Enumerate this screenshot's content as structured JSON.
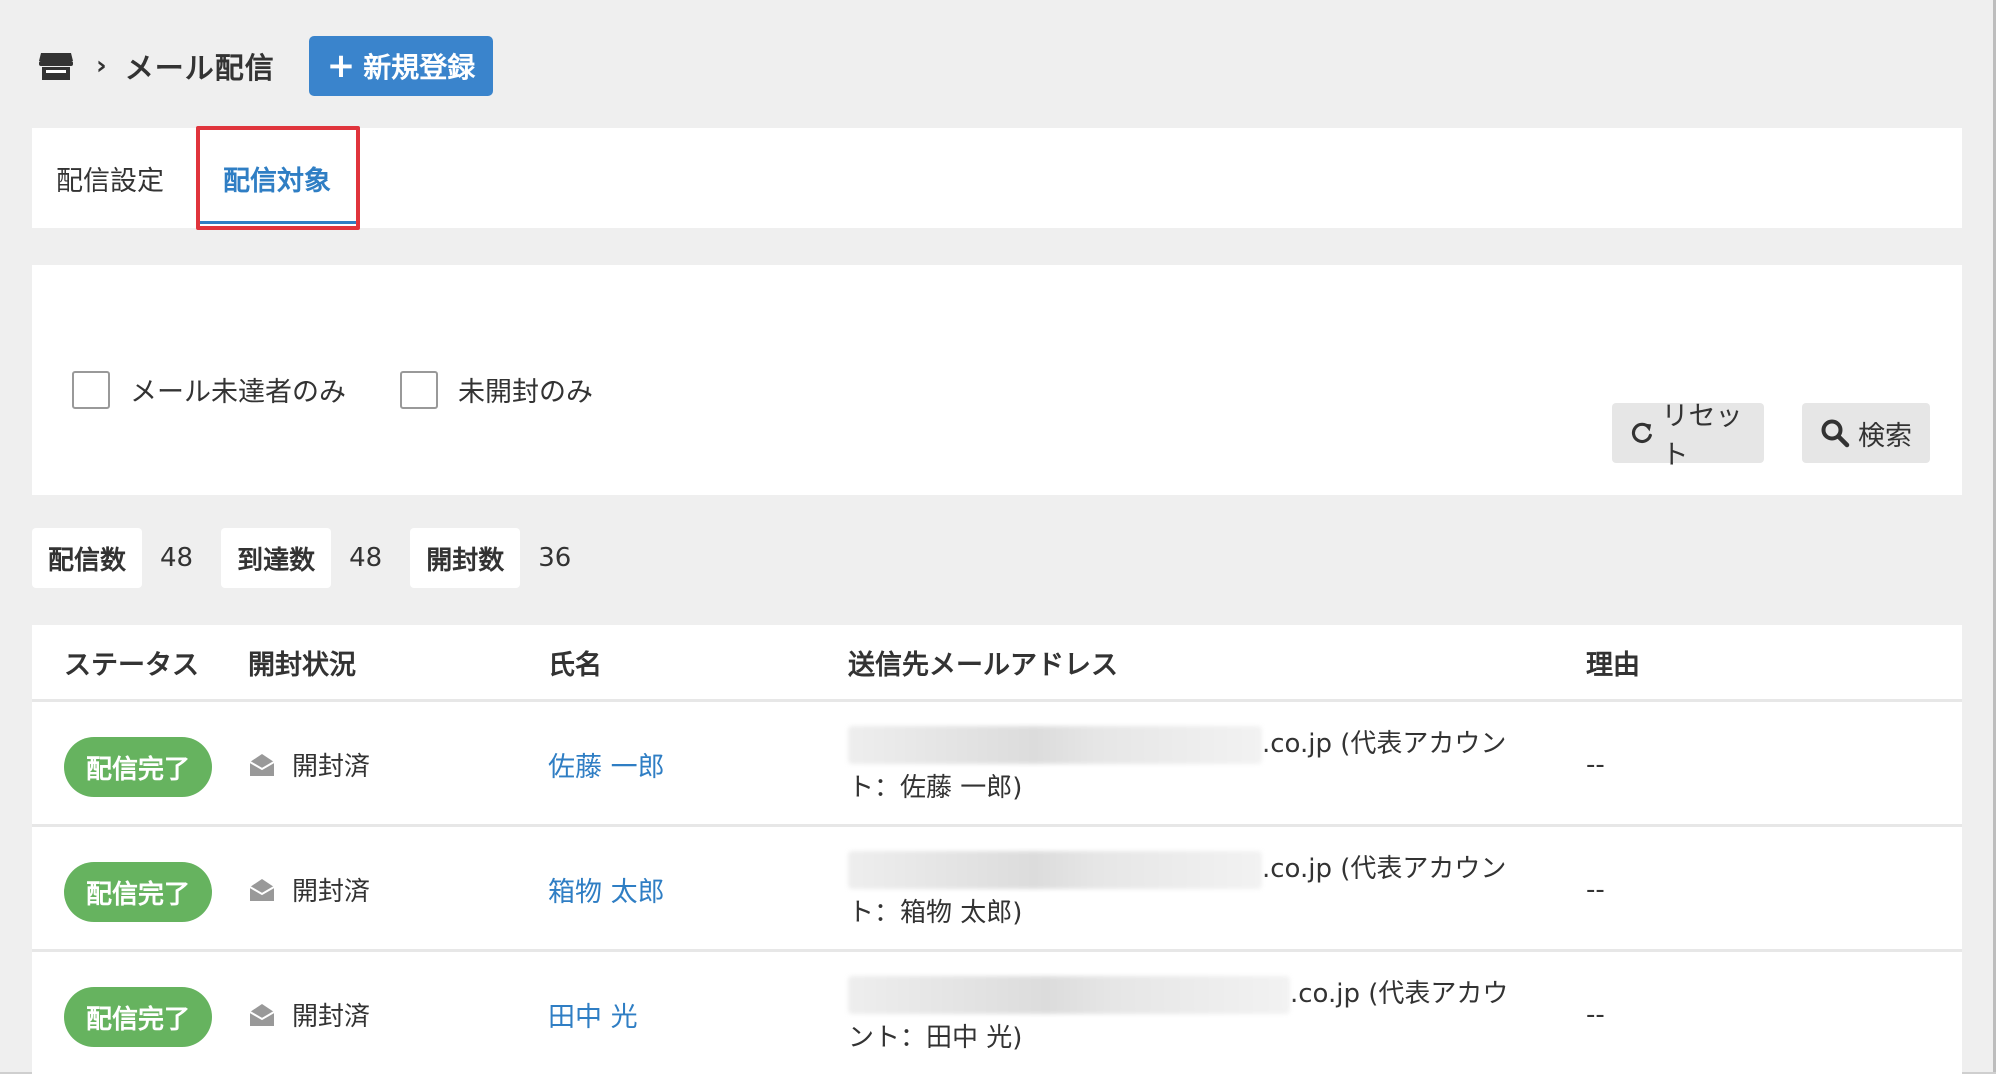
{
  "header": {
    "breadcrumb_home_icon": "store-icon",
    "breadcrumb_separator": "›",
    "title": "メール配信",
    "new_button_label": "新規登録",
    "accent_color": "#3a84cc"
  },
  "tabs": [
    {
      "label": "配信設定",
      "active": false
    },
    {
      "label": "配信対象",
      "active": true
    }
  ],
  "filters": {
    "undelivered_only": {
      "label": "メール未達者のみ",
      "checked": false
    },
    "unopened_only": {
      "label": "未開封のみ",
      "checked": false
    },
    "reset_label": "リセット",
    "search_label": "検索"
  },
  "counts": [
    {
      "label": "配信数",
      "value": "48"
    },
    {
      "label": "到達数",
      "value": "48"
    },
    {
      "label": "開封数",
      "value": "36"
    }
  ],
  "table": {
    "headers": [
      "ステータス",
      "開封状況",
      "氏名",
      "送信先メールアドレス",
      "理由"
    ],
    "rows": [
      {
        "status": "配信完了",
        "open_status": "開封済",
        "name": "佐藤 一郎",
        "email_suffix": ".co.jp (代表アカウン",
        "email_line2": "ト：佐藤 一郎)",
        "reason": "--"
      },
      {
        "status": "配信完了",
        "open_status": "開封済",
        "name": "箱物 太郎",
        "email_suffix": ".co.jp (代表アカウン",
        "email_line2": "ト：箱物 太郎)",
        "reason": "--"
      },
      {
        "status": "配信完了",
        "open_status": "開封済",
        "name": "田中 光",
        "email_suffix": ".co.jp (代表アカウ",
        "email_line2": "ント：田中 光)",
        "reason": "--"
      }
    ]
  },
  "colors": {
    "status_complete": "#66b35f",
    "link": "#2f7ec4",
    "highlight_box": "#e0343c"
  }
}
